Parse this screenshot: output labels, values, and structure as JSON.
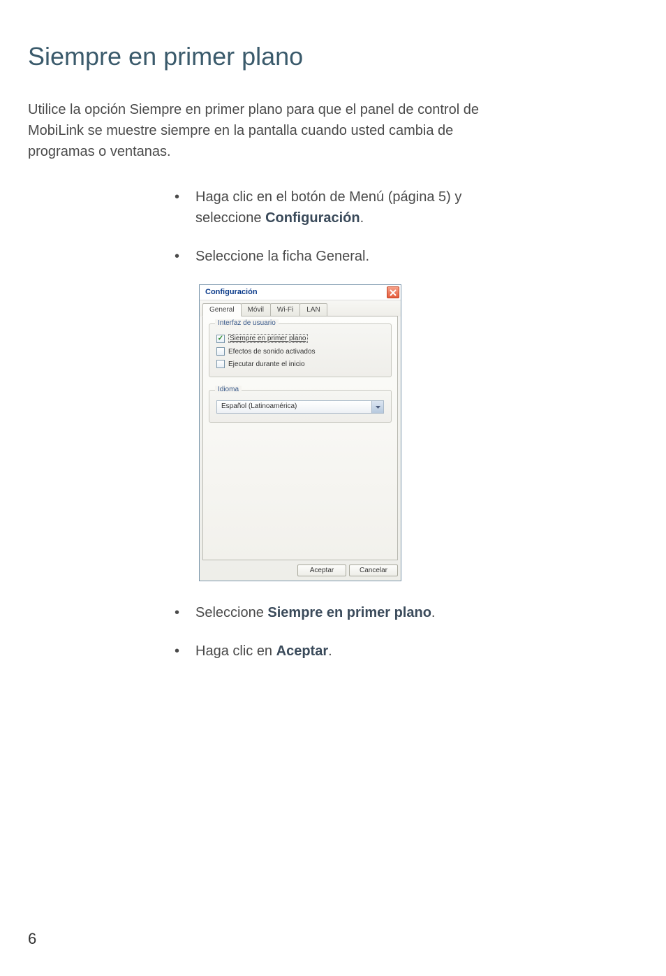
{
  "page": {
    "title": "Siempre en primer plano",
    "intro": "Utilice la opción Siempre en primer plano para que el panel de control de MobiLink se muestre siempre en la pantalla cuando usted cambia de programas o ventanas.",
    "pageNumber": "6"
  },
  "bullets": {
    "b1_prefix": "Haga clic en el botón de Menú (página 5) y seleccione ",
    "b1_bold": "Configuración",
    "b1_suffix": ".",
    "b2": "Seleccione la ficha General.",
    "b3_prefix": "Seleccione ",
    "b3_bold": "Siempre en primer plano",
    "b3_suffix": ".",
    "b4_prefix": "Haga clic en ",
    "b4_bold": "Aceptar",
    "b4_suffix": "."
  },
  "dialog": {
    "title": "Configuración",
    "tabs": {
      "general": "General",
      "movil": "Móvil",
      "wifi": "Wi-Fi",
      "lan": "LAN"
    },
    "groups": {
      "ui_legend": "Interfaz de usuario",
      "lang_legend": "Idioma"
    },
    "checkboxes": {
      "always_top": "Siempre en primer plano",
      "sound": "Efectos de sonido activados",
      "startup": "Ejecutar durante el inicio"
    },
    "dropdown": {
      "language_value": "Español (Latinoamérica)"
    },
    "buttons": {
      "ok": "Aceptar",
      "cancel": "Cancelar"
    }
  }
}
